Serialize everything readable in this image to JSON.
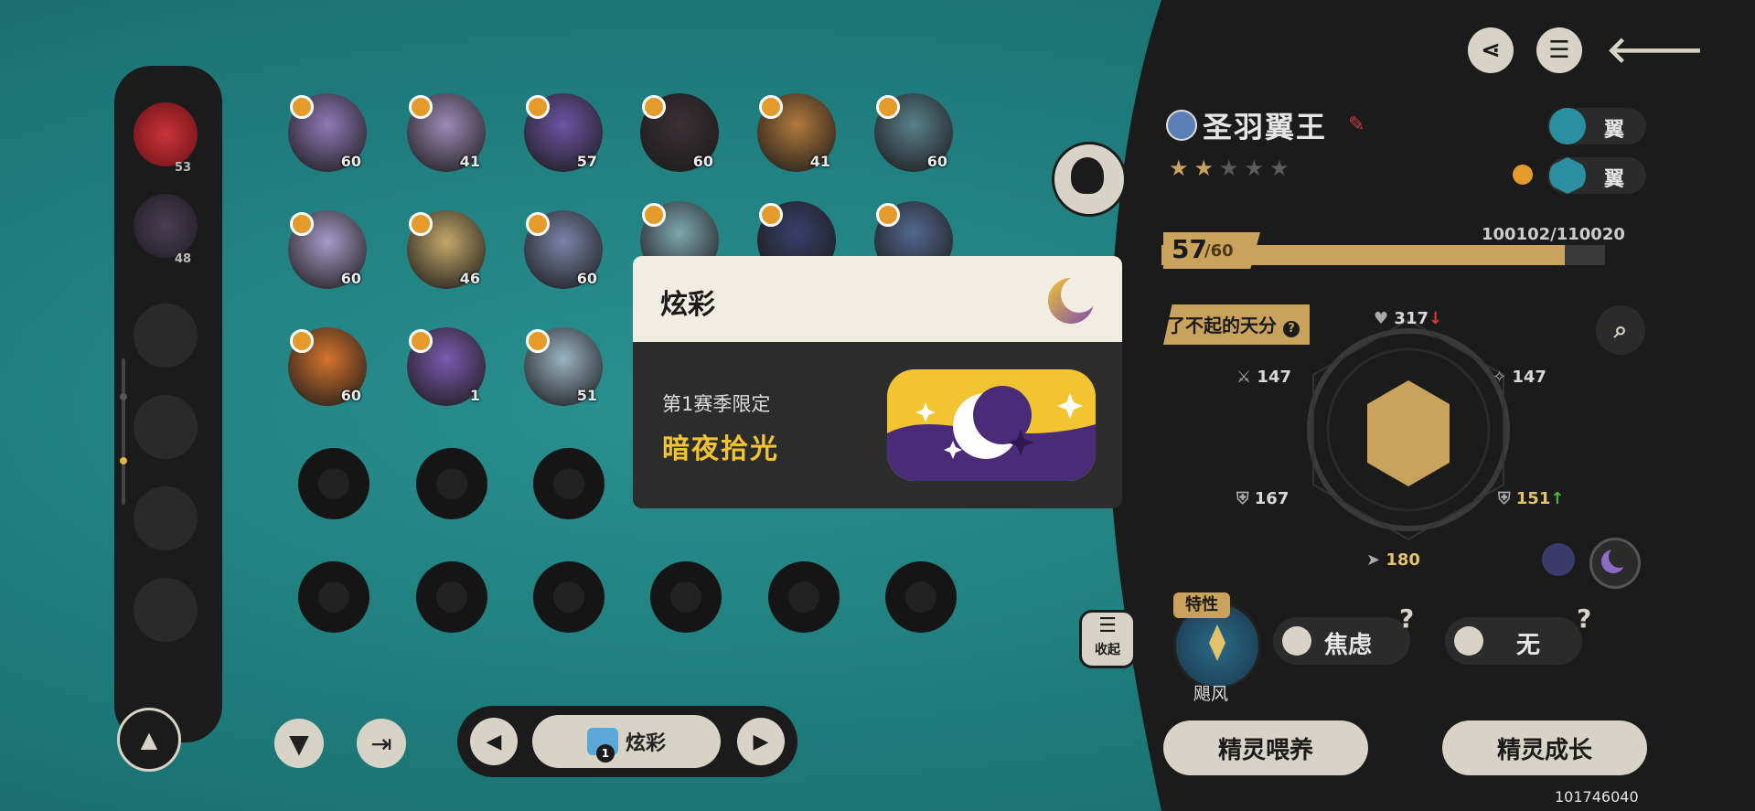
{
  "colors": {
    "accent_gold": "#c9a25c",
    "panel_dark": "#1b1b1b",
    "teal": "#1e7a7a",
    "skin_yellow": "#f2c431"
  },
  "sidebar": {
    "slots": [
      {
        "level": "53",
        "filled": true
      },
      {
        "level": "48",
        "filled": true
      },
      {
        "level": "",
        "filled": false
      },
      {
        "level": "",
        "filled": false
      },
      {
        "level": "",
        "filled": false
      },
      {
        "level": "",
        "filled": false
      },
      {
        "level": "",
        "filled": false
      }
    ]
  },
  "grid": {
    "pets": [
      {
        "level": "60",
        "color": "#8f7ab8"
      },
      {
        "level": "41",
        "color": "#9d8bb7"
      },
      {
        "level": "57",
        "color": "#6d55a5"
      },
      {
        "level": "60",
        "color": "#3a3035"
      },
      {
        "level": "41",
        "color": "#b27a3c"
      },
      {
        "level": "60",
        "color": "#5a7f8b"
      },
      {
        "level": "60",
        "color": "#a79bc8"
      },
      {
        "level": "46",
        "color": "#c4a86a"
      },
      {
        "level": "60",
        "color": "#7b84a8"
      },
      {
        "level": "",
        "color": "#7fa7b0"
      },
      {
        "level": "",
        "color": "#3a3f6a"
      },
      {
        "level": "",
        "color": "#52688e"
      },
      {
        "level": "60",
        "color": "#d6742c"
      },
      {
        "level": "1",
        "color": "#7b5bb0"
      },
      {
        "level": "51",
        "color": "#9ab4c3"
      }
    ]
  },
  "bottom_nav": {
    "prev": "◀",
    "next": "▶",
    "label": "炫彩",
    "count": "1"
  },
  "popup": {
    "title": "炫彩",
    "season": "第1赛季限定",
    "skin_name": "暗夜拾光"
  },
  "pet": {
    "name": "圣羽翼王",
    "stars": "★★★★★",
    "type1": "翼",
    "type2": "翼",
    "level": "57",
    "level_max": "/60",
    "exp": "100102/110020",
    "exp_fraction": 0.91,
    "talent": "了不起的天分",
    "stats": {
      "hp": "317",
      "atk": "147",
      "sp_atk": "147",
      "def": "167",
      "sp_def": "151",
      "speed": "180"
    },
    "trait_tag": "特性",
    "trait_name": "飓风",
    "nature": "焦虑",
    "item": "无",
    "collapse": "收起",
    "feed_btn": "精灵喂养",
    "grow_btn": "精灵成长"
  },
  "footer": {
    "uid": "101746040"
  },
  "top_icons": {
    "share": "share-icon",
    "list": "list-icon",
    "back": "back-icon"
  }
}
